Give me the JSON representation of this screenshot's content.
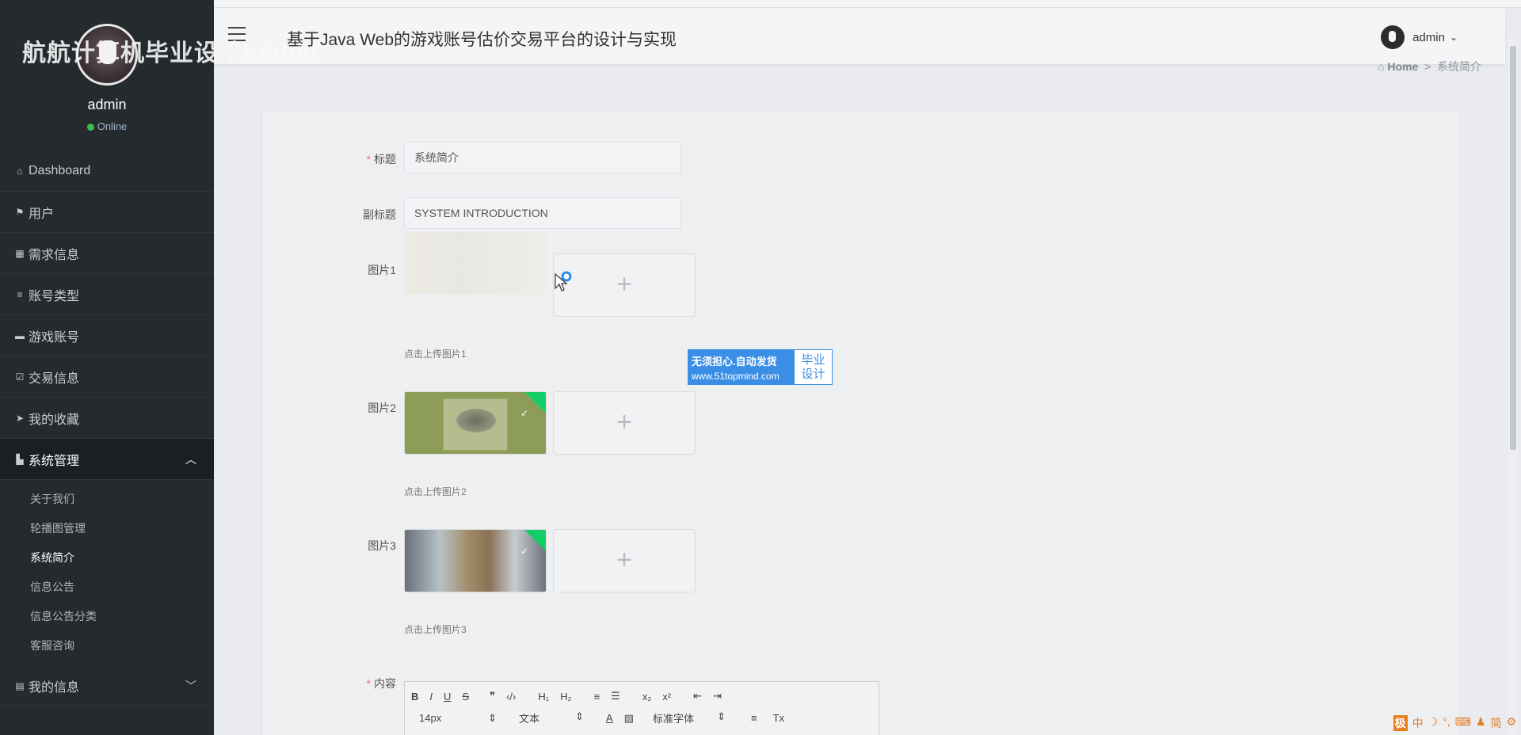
{
  "watermark": {
    "title": "航航计算机毕业设计",
    "ghost": "bilibili"
  },
  "sidebar": {
    "profile": {
      "name": "admin",
      "status": "Online"
    },
    "items": [
      {
        "label": "Dashboard",
        "icon": "home-icon"
      },
      {
        "label": "用户",
        "icon": "flag-icon"
      },
      {
        "label": "需求信息",
        "icon": "grid-icon"
      },
      {
        "label": "账号类型",
        "icon": "list-icon"
      },
      {
        "label": "游戏账号",
        "icon": "monitor-icon"
      },
      {
        "label": "交易信息",
        "icon": "checkbox-icon"
      },
      {
        "label": "我的收藏",
        "icon": "send-icon"
      },
      {
        "label": "系统管理",
        "icon": "chart-icon"
      },
      {
        "label": "我的信息",
        "icon": "card-icon"
      }
    ],
    "submenu": [
      "关于我们",
      "轮播图管理",
      "系统简介",
      "信息公告",
      "信息公告分类",
      "客服咨询"
    ]
  },
  "header": {
    "title": "基于Java Web的游戏账号估价交易平台的设计与实现",
    "user": "admin"
  },
  "breadcrumb": {
    "home": "Home",
    "separator": ">",
    "current": "系统简介"
  },
  "form": {
    "title_label": "标题",
    "title_value": "系统简介",
    "subtitle_label": "副标题",
    "subtitle_value": "SYSTEM INTRODUCTION",
    "image1_label": "图片1",
    "image1_tip": "点击上传图片1",
    "image2_label": "图片2",
    "image2_tip": "点击上传图片2",
    "image3_label": "图片3",
    "image3_tip": "点击上传图片3",
    "content_label": "内容",
    "required_mark": "*",
    "upload_plus": "+"
  },
  "ad": {
    "line1": "无须担心.自动发货",
    "line2": "www.51topmind.com",
    "right1": "毕业",
    "right2": "设计"
  },
  "editor": {
    "row1": [
      "B",
      "I",
      "U",
      "S",
      "❞",
      "‹/›",
      "H₁",
      "H₂",
      "≡",
      "☰",
      "x₂",
      "x²",
      "⇤",
      "⇥"
    ],
    "font_size": "14px",
    "block_type": "文本",
    "font_family": "标准字体",
    "row2_icons": [
      "A",
      "▨",
      "≡",
      "Tx"
    ]
  },
  "tray": [
    "中",
    "☽",
    "°,",
    "⌨",
    "♟",
    "简",
    "⚙"
  ],
  "tray_box": "极"
}
